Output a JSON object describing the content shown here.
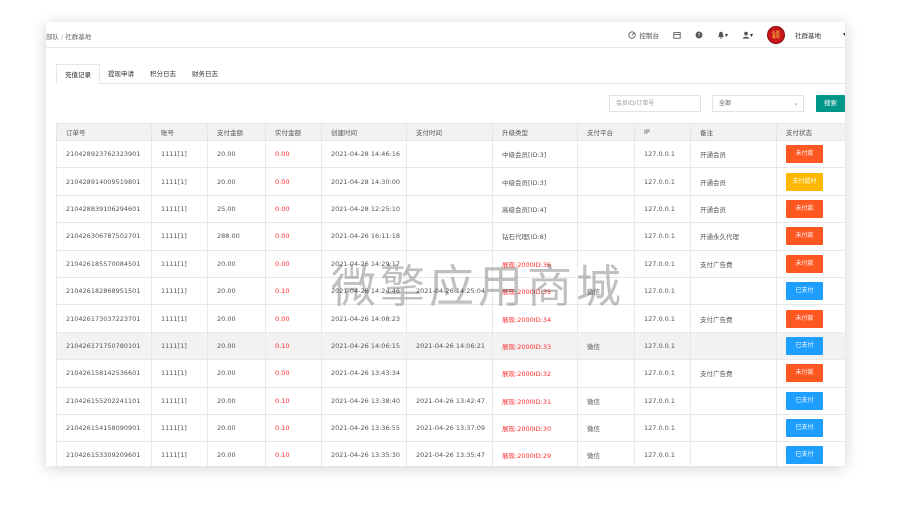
{
  "breadcrumb": {
    "prefix": "部队",
    "current": "社群基地"
  },
  "topbar": {
    "console_label": "控制台",
    "username": "社群基地",
    "avatar_text": "社群基地"
  },
  "tabs": [
    "充值记录",
    "提现申请",
    "积分日志",
    "财务日志"
  ],
  "filters": {
    "search_placeholder": "会员ID/订单号",
    "status_selected": "全部",
    "search_button": "搜索"
  },
  "table": {
    "headers": [
      "订单号",
      "账号",
      "支付金额",
      "实付金额",
      "创建时间",
      "支付时间",
      "升级类型",
      "支付平台",
      "IP",
      "备注",
      "支付状态"
    ],
    "rows": [
      {
        "order": "210428923762323901",
        "account": "1111[1]",
        "pay": "20.00",
        "actual": "0.00",
        "created": "2021-04-28 14:46:16",
        "paid_at": "",
        "type": "中级会员[ID:3]",
        "type_red": false,
        "platform": "",
        "ip": "127.0.0.1",
        "note": "开通会员",
        "status": "未付款",
        "status_kind": "unpaid"
      },
      {
        "order": "210428914009519801",
        "account": "1111[1]",
        "pay": "20.00",
        "actual": "0.00",
        "created": "2021-04-28 14:30:00",
        "paid_at": "",
        "type": "中级会员[ID:3]",
        "type_red": false,
        "platform": "",
        "ip": "127.0.0.1",
        "note": "开通会员",
        "status": "支付超时",
        "status_kind": "timeout"
      },
      {
        "order": "210428839106294601",
        "account": "1111[1]",
        "pay": "25.00",
        "actual": "0.00",
        "created": "2021-04-28 12:25:10",
        "paid_at": "",
        "type": "高级会员[ID:4]",
        "type_red": false,
        "platform": "",
        "ip": "127.0.0.1",
        "note": "开通会员",
        "status": "未付款",
        "status_kind": "unpaid"
      },
      {
        "order": "210426306787502701",
        "account": "1111[1]",
        "pay": "288.00",
        "actual": "0.00",
        "created": "2021-04-26 16:11:18",
        "paid_at": "",
        "type": "钻石代理[ID:8]",
        "type_red": false,
        "platform": "",
        "ip": "127.0.0.1",
        "note": "开通永久代理",
        "status": "未付款",
        "status_kind": "unpaid"
      },
      {
        "order": "210426185570084501",
        "account": "1111[1]",
        "pay": "20.00",
        "actual": "0.00",
        "created": "2021-04-26 14:29:17",
        "paid_at": "",
        "type": "展现:2000ID:36",
        "type_red": true,
        "platform": "",
        "ip": "127.0.0.1",
        "note": "支付广告费",
        "status": "未付款",
        "status_kind": "unpaid"
      },
      {
        "order": "210426182868951501",
        "account": "1111[1]",
        "pay": "20.00",
        "actual": "0.10",
        "created": "2021-04-26 14:24:46",
        "paid_at": "2021-04-26 14:25:04",
        "type": "展现:2000ID:35",
        "type_red": true,
        "platform": "微信",
        "ip": "127.0.0.1",
        "note": "",
        "status": "已支付",
        "status_kind": "paid"
      },
      {
        "order": "210426173037223701",
        "account": "1111[1]",
        "pay": "20.00",
        "actual": "0.00",
        "created": "2021-04-26 14:08:23",
        "paid_at": "",
        "type": "展现:2000ID:34",
        "type_red": true,
        "platform": "",
        "ip": "127.0.0.1",
        "note": "支付广告费",
        "status": "未付款",
        "status_kind": "unpaid"
      },
      {
        "order": "210426171750780101",
        "account": "1111[1]",
        "pay": "20.00",
        "actual": "0.10",
        "created": "2021-04-26 14:06:15",
        "paid_at": "2021-04-26 14:06:21",
        "type": "展现:2000ID:33",
        "type_red": true,
        "platform": "微信",
        "ip": "127.0.0.1",
        "note": "",
        "status": "已支付",
        "status_kind": "paid"
      },
      {
        "order": "210426158142536601",
        "account": "1111[1]",
        "pay": "20.00",
        "actual": "0.00",
        "created": "2021-04-26 13:43:34",
        "paid_at": "",
        "type": "展现:2000ID:32",
        "type_red": true,
        "platform": "",
        "ip": "127.0.0.1",
        "note": "支付广告费",
        "status": "未付款",
        "status_kind": "unpaid"
      },
      {
        "order": "210426155202241101",
        "account": "1111[1]",
        "pay": "20.00",
        "actual": "0.10",
        "created": "2021-04-26 13:38:40",
        "paid_at": "2021-04-26 13:42:47",
        "type": "展现:2000ID:31",
        "type_red": true,
        "platform": "微信",
        "ip": "127.0.0.1",
        "note": "",
        "status": "已支付",
        "status_kind": "paid"
      },
      {
        "order": "210426154158090901",
        "account": "1111[1]",
        "pay": "20.00",
        "actual": "0.10",
        "created": "2021-04-26 13:36:55",
        "paid_at": "2021-04-26 13:37:09",
        "type": "展现:2000ID:30",
        "type_red": true,
        "platform": "微信",
        "ip": "127.0.0.1",
        "note": "",
        "status": "已支付",
        "status_kind": "paid"
      },
      {
        "order": "210426153309209601",
        "account": "1111[1]",
        "pay": "20.00",
        "actual": "0.10",
        "created": "2021-04-26 13:35:30",
        "paid_at": "2021-04-26 13:35:47",
        "type": "展现:2000ID:29",
        "type_red": true,
        "platform": "微信",
        "ip": "127.0.0.1",
        "note": "",
        "status": "已支付",
        "status_kind": "paid"
      }
    ]
  },
  "highlighted_row": 7,
  "watermark": "微擎应用商城"
}
